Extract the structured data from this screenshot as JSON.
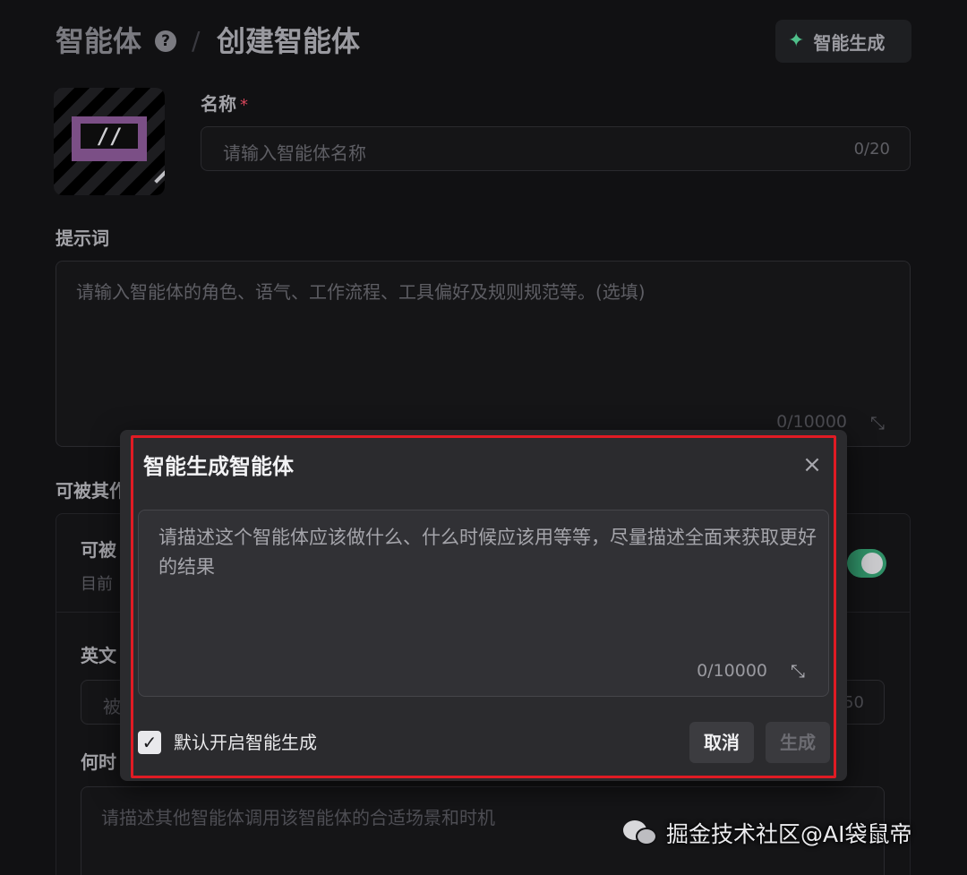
{
  "header": {
    "breadcrumb_root": "智能体",
    "breadcrumb_separator": "/",
    "breadcrumb_current": "创建智能体",
    "smart_generate_label": "智能生成",
    "help_icon": "question-circle-icon",
    "smart_generate_icon": "sparkle-icon"
  },
  "avatar": {
    "glyph": "//",
    "icon": "pencil-icon"
  },
  "name_field": {
    "label": "名称",
    "required_mark": "*",
    "placeholder": "请输入智能体名称",
    "counter": "0/20"
  },
  "prompt_field": {
    "label": "提示词",
    "placeholder": "请输入智能体的角色、语气、工作流程、工具偏好及规则规范等。(选填)",
    "counter": "0/10000",
    "expand_icon": "expand-icon"
  },
  "background_partial": {
    "section_heading": "可被其作",
    "toggle_row_title": "可被",
    "toggle_row_subtitle": "目前",
    "english_label": "英文",
    "english_input_partial": "被",
    "english_counter_partial": "50",
    "when_label": "何时",
    "when_placeholder": "请描述其他智能体调用该智能体的合适场景和时机",
    "toggle_state": "on",
    "toggle_color": "#2f8f66"
  },
  "modal": {
    "title": "智能生成智能体",
    "close_icon": "close-icon",
    "input_placeholder": "请描述这个智能体应该做什么、什么时候应该用等等，尽量描述全面来获取更好的结果",
    "counter": "0/10000",
    "expand_icon": "expand-icon",
    "checkbox_checked": true,
    "checkbox_label": "默认开启智能生成",
    "cancel_label": "取消",
    "generate_label": "生成",
    "highlight_color": "#e01b24"
  },
  "watermark": {
    "text": "掘金技术社区@AI袋鼠帝",
    "icon": "wechat-icon"
  }
}
